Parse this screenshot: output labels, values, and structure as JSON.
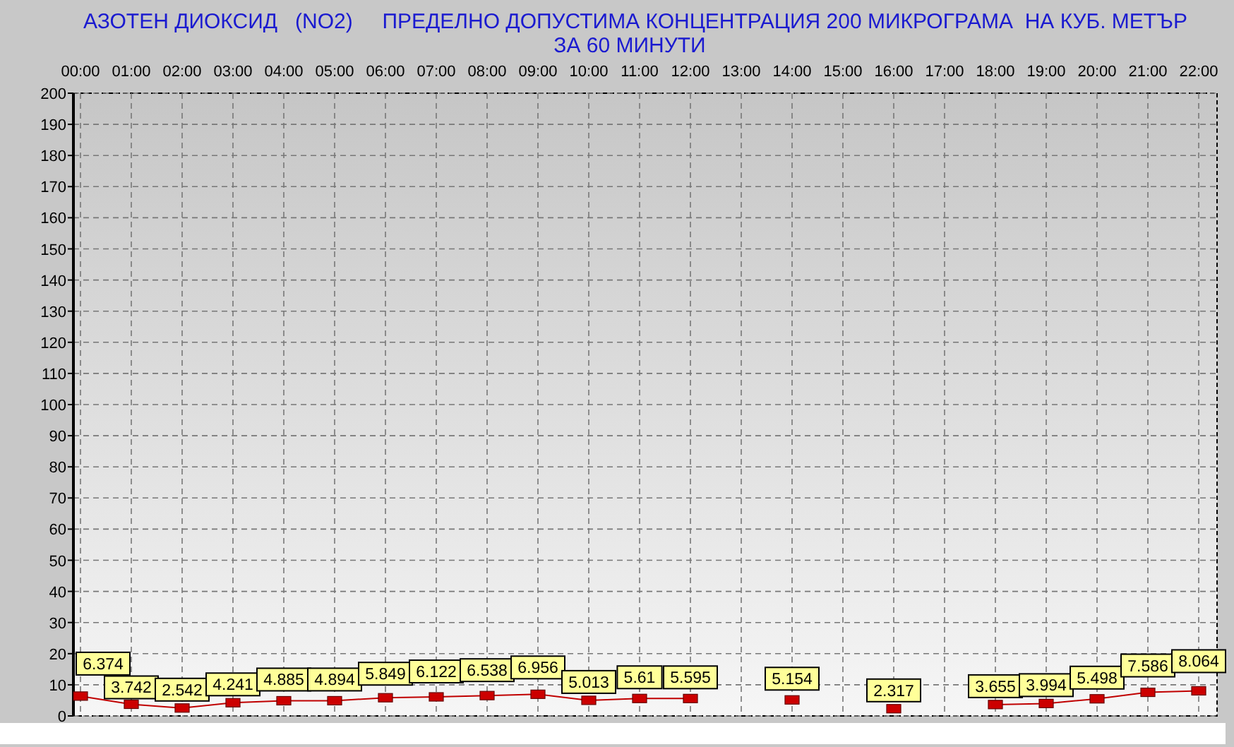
{
  "header": {
    "lines": [
      "АЗОТЕН ДИОКСИД   (NO2)     ПРЕДЕЛНО ДОПУСТИМА КОНЦЕНТРАЦИЯ 200 МИКРОГРАМА  НА КУБ. МЕТЪР",
      "ЗА 60 МИНУТИ"
    ]
  },
  "chart_data": {
    "type": "line",
    "data_labels": true,
    "grid": true,
    "marker": "square",
    "categories": [
      "00:00",
      "01:00",
      "02:00",
      "03:00",
      "04:00",
      "05:00",
      "06:00",
      "07:00",
      "08:00",
      "09:00",
      "10:00",
      "11:00",
      "12:00",
      "13:00",
      "14:00",
      "15:00",
      "16:00",
      "17:00",
      "18:00",
      "19:00",
      "20:00",
      "21:00",
      "22:00"
    ],
    "values": [
      6.374,
      3.742,
      2.542,
      4.241,
      4.885,
      4.894,
      5.849,
      6.122,
      6.538,
      6.956,
      5.013,
      5.61,
      5.595,
      null,
      5.154,
      null,
      2.317,
      null,
      3.655,
      3.994,
      5.498,
      7.586,
      8.064
    ],
    "value_labels": [
      "6.374",
      "3.742",
      "2.542",
      "4.241",
      "4.885",
      "4.894",
      "5.849",
      "6.122",
      "6.538",
      "6.956",
      "5.013",
      "5.61",
      "5.595",
      null,
      "5.154",
      null,
      "2.317",
      null,
      "3.655",
      "3.994",
      "5.498",
      "7.586",
      "8.064"
    ],
    "ylim": [
      0,
      200
    ],
    "yticks": [
      0,
      10,
      20,
      30,
      40,
      50,
      60,
      70,
      80,
      90,
      100,
      110,
      120,
      130,
      140,
      150,
      160,
      170,
      180,
      190,
      200
    ]
  }
}
